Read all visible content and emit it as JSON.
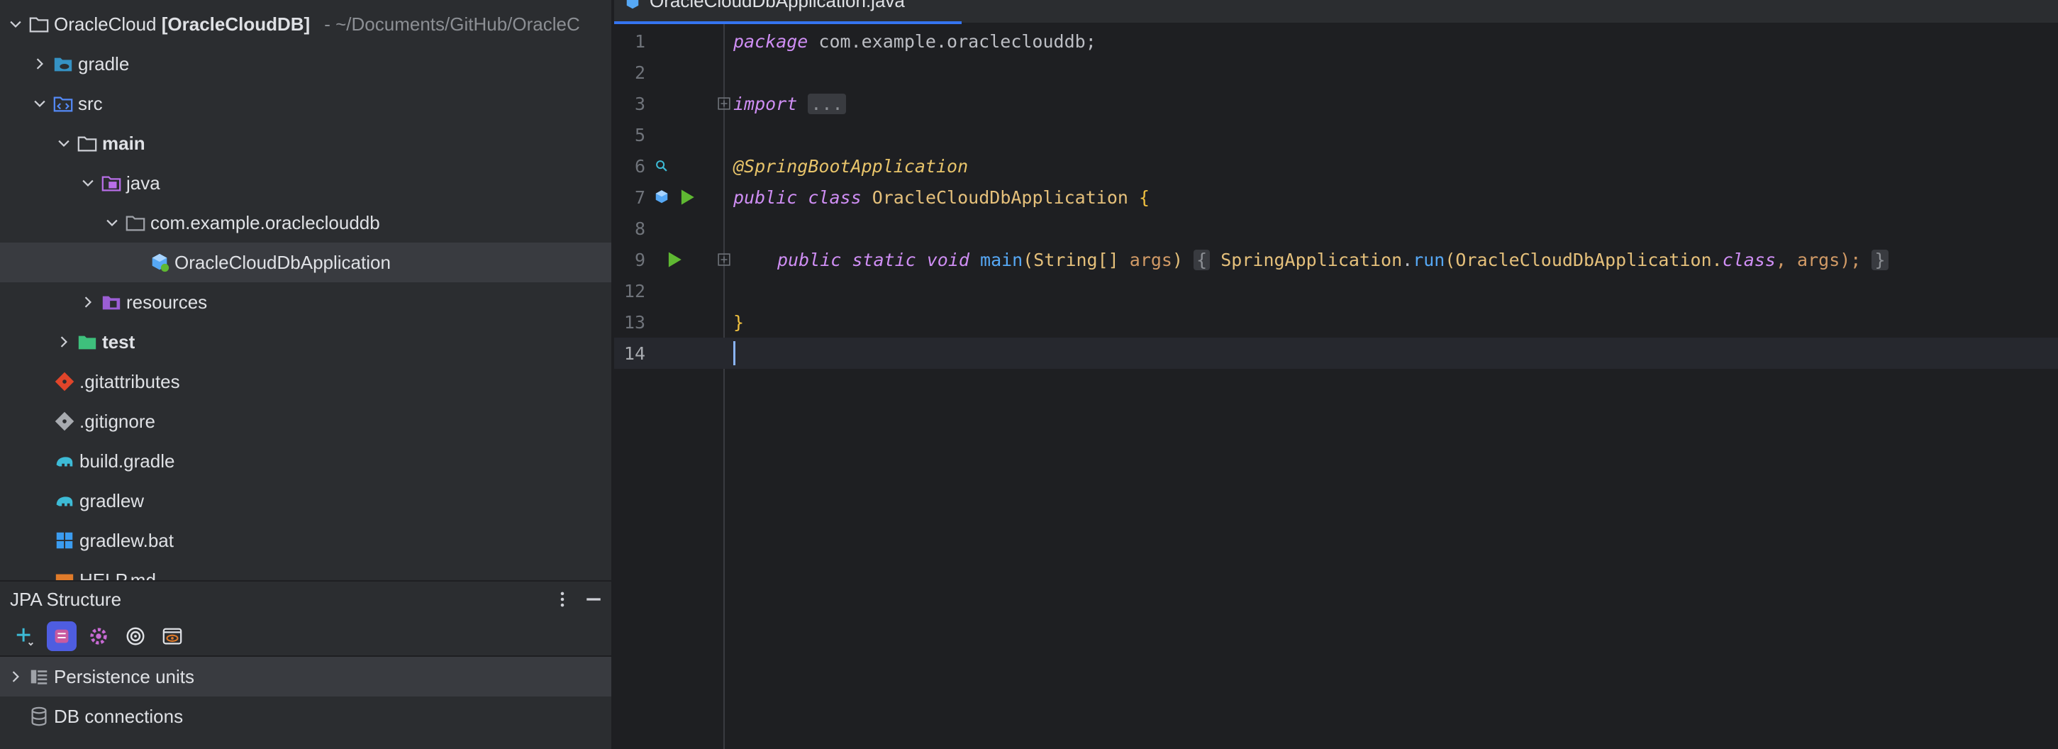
{
  "project_tree": {
    "root": {
      "name": "OracleCloud",
      "module": "[OracleCloudDB]",
      "path": "~/Documents/GitHub/OracleC"
    },
    "items": [
      {
        "label": "gradle",
        "icon": "gradle-folder-icon"
      },
      {
        "label": "src",
        "icon": "source-folder-icon"
      },
      {
        "label": "main",
        "icon": "folder-icon"
      },
      {
        "label": "java",
        "icon": "java-source-root-icon"
      },
      {
        "label": "com.example.oracleclouddb",
        "icon": "package-icon"
      },
      {
        "label": "OracleCloudDbApplication",
        "icon": "spring-boot-class-icon"
      },
      {
        "label": "resources",
        "icon": "resources-folder-icon"
      },
      {
        "label": "test",
        "icon": "test-folder-icon"
      },
      {
        "label": ".gitattributes",
        "icon": "git-icon"
      },
      {
        "label": ".gitignore",
        "icon": "gitignore-icon"
      },
      {
        "label": "build.gradle",
        "icon": "gradle-elephant-icon"
      },
      {
        "label": "gradlew",
        "icon": "gradle-elephant-icon"
      },
      {
        "label": "gradlew.bat",
        "icon": "windows-icon"
      },
      {
        "label": "HELP.md",
        "icon": "markdown-icon"
      }
    ]
  },
  "jpa_structure": {
    "title": "JPA Structure",
    "items": [
      {
        "label": "Persistence units"
      },
      {
        "label": "DB connections"
      }
    ]
  },
  "editor": {
    "tab_label": "OracleCloudDbApplication.java",
    "line_numbers": [
      "1",
      "2",
      "3",
      "5",
      "6",
      "7",
      "8",
      "9",
      "12",
      "13",
      "14"
    ],
    "code": {
      "l1_kw": "package",
      "l1_rest": " com.example.oracleclouddb;",
      "l3_kw": "import",
      "l3_fold": "...",
      "l6_annotation": "@SpringBootApplication",
      "l7_kw1": "public",
      "l7_kw2": "class",
      "l7_cls": "OracleCloudDbApplication",
      "l7_brace": "{",
      "l9_kw1": "public",
      "l9_kw2": "static",
      "l9_kw3": "void",
      "l9_fn": "main",
      "l9_p1": "(String[]",
      "l9_prm": "args",
      "l9_p2": ")",
      "l9_ob": "{",
      "l9_cls": "SpringApplication",
      "l9_dot": ".",
      "l9_run": "run",
      "l9_arg1": "(OracleCloudDbApplication.",
      "l9_kwcls": "class",
      "l9_arg2": ", args);",
      "l9_cb": "}",
      "l13_brace": "}"
    }
  },
  "colors": {
    "keyword": "#cf8ef4",
    "annotation": "#e8c46a",
    "function": "#56a8f5",
    "accent": "#3574f0"
  }
}
